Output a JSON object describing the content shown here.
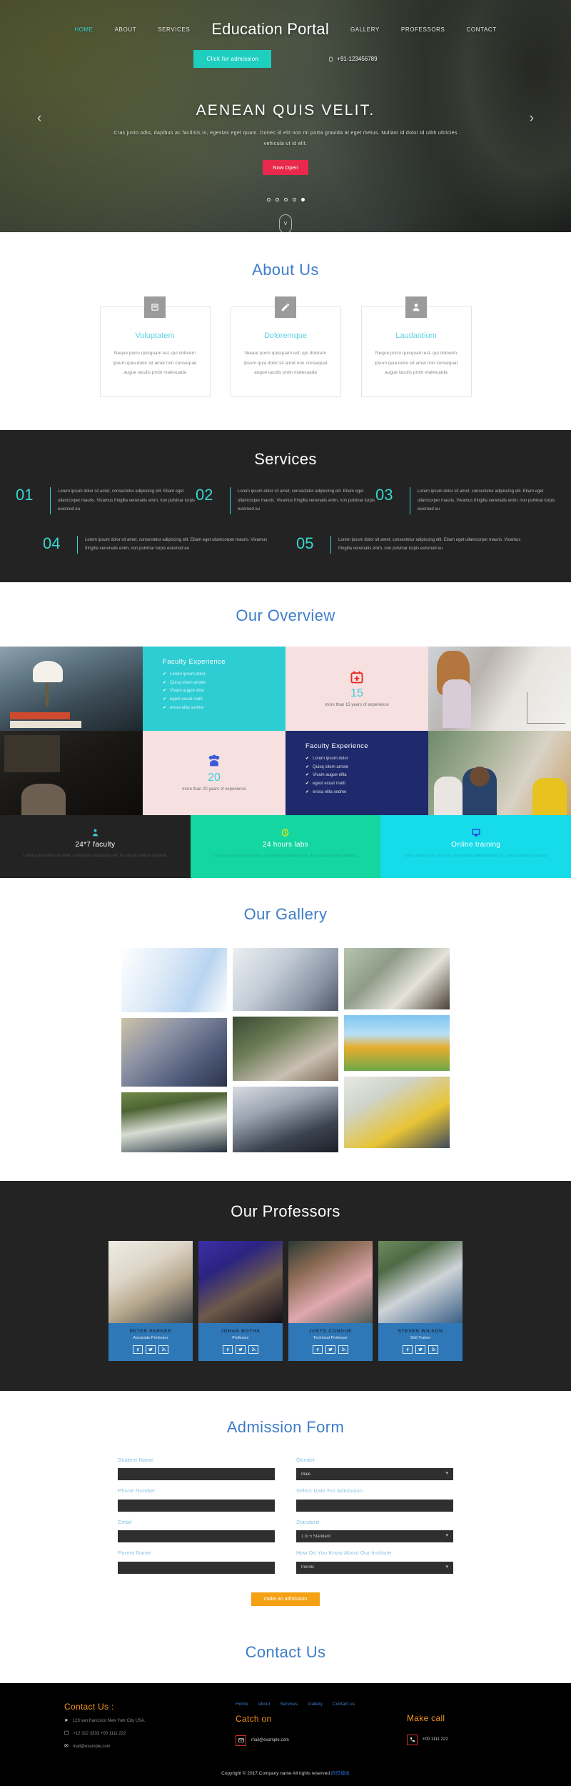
{
  "header": {
    "brand": "Education Portal",
    "nav_left": [
      {
        "label": "HOME",
        "active": true
      },
      {
        "label": "ABOUT",
        "active": false
      },
      {
        "label": "SERVICES",
        "active": false
      }
    ],
    "nav_right": [
      {
        "label": "GALLERY",
        "active": false
      },
      {
        "label": "PROFESSORS",
        "active": false
      },
      {
        "label": "CONTACT",
        "active": false
      }
    ],
    "admission_button": "Click for admission",
    "phone": "+91-123456789"
  },
  "hero": {
    "title": "AENEAN QUIS VELIT.",
    "description": "Cras justo odio, dapibus ac facilisis in, egestas eget quam. Donec id elit non mi porta gravida at eget metus. Nullam id dolor id nibh ultricies vehicula ut id elit.",
    "cta": "Now Open",
    "arrow_prev": "‹",
    "arrow_next": "›",
    "dots": [
      false,
      false,
      false,
      false,
      true
    ],
    "scroll_chevron": "˅",
    "accent_cta": "#e8294b"
  },
  "about": {
    "title": "About Us",
    "cards": [
      {
        "icon": "book-icon",
        "heading": "Voluptatem",
        "body": "Neque porro quisquam est, qui dolorem ipsum quia dolor sit amet non consequat augue iaculis proin malesuada"
      },
      {
        "icon": "pencil-icon",
        "heading": "Doloremque",
        "body": "Neque porro quisquam est, qui dolorem ipsum quia dolor sit amet non consequat augue iaculis proin malesuada"
      },
      {
        "icon": "user-icon",
        "heading": "Laudantium",
        "body": "Neque porro quisquam est, qui dolorem ipsum quia dolor sit amet non consequat augue iaculis proin malesuada"
      }
    ]
  },
  "services": {
    "title": "Services",
    "short_text": "Lorem ipsum dolor sit amet, consectetur adipiscing elit. Etiam eget ullamcorper mauris. Vivamus fringilla venenatis enim, non pulvinar turpis euismod eu",
    "items_row1": [
      {
        "num": "01"
      },
      {
        "num": "02"
      },
      {
        "num": "03"
      }
    ],
    "items_row2": [
      {
        "num": "04"
      },
      {
        "num": "05"
      }
    ]
  },
  "overview": {
    "title": "Our Overview",
    "faculty_heading": "Faculty Experience",
    "faculty_list": [
      "Lorem ipsum dolor",
      "Quisq sitem amete",
      "Vivam augue elita",
      "egest exuat matti",
      "erosa elita sedme"
    ],
    "stat_15": {
      "icon": "calendar-plus-icon",
      "number": "15",
      "caption": "more than 15 years of experience"
    },
    "stat_20": {
      "icon": "group-users-icon",
      "number": "20",
      "caption": "more than 20 years of experience"
    },
    "strip_text": "Lorem ipsum dolor sit amet, consectetur adipiscing elit. In congue pretium placerat.",
    "strips": [
      {
        "icon": "person-icon",
        "title": "24*7 faculty"
      },
      {
        "icon": "clock-icon",
        "title": "24 hours labs"
      },
      {
        "icon": "monitor-icon",
        "title": "Online training"
      }
    ]
  },
  "gallery": {
    "title": "Our Gallery"
  },
  "professors": {
    "title": "Our Professors",
    "people": [
      {
        "name": "PETER PARKER",
        "role": "Associate Professor"
      },
      {
        "name": "JOHAN BOTHA",
        "role": "Professor"
      },
      {
        "name": "JUSTO CONGUE",
        "role": "Technical Professor"
      },
      {
        "name": "STEVEN WILSON",
        "role": "Skill Trainer"
      }
    ],
    "social": [
      "facebook-icon",
      "twitter-icon",
      "rss-icon"
    ]
  },
  "admission": {
    "title": "Admission Form",
    "fields_left": [
      {
        "label": "Student Name",
        "type": "text",
        "value": ""
      },
      {
        "label": "Phone Number",
        "type": "text",
        "value": ""
      },
      {
        "label": "Email",
        "type": "text",
        "value": ""
      },
      {
        "label": "Parent Name",
        "type": "text",
        "value": ""
      }
    ],
    "fields_right": [
      {
        "label": "Gender",
        "type": "select",
        "value": "Male"
      },
      {
        "label": "Select Date For Admission",
        "type": "text",
        "value": ""
      },
      {
        "label": "Standard",
        "type": "select",
        "value": "1 to 5 Standard"
      },
      {
        "label": "How Do You Know About Our Institute",
        "type": "select",
        "value": "friends"
      }
    ],
    "submit": "make an admission"
  },
  "contact": {
    "title": "Contact Us"
  },
  "footer": {
    "contact_heading": "Contact Us :",
    "address": "123 san francisco New York City USA.",
    "phones": "+12 322 3333 +00 1111 222",
    "email": "mail@example.com",
    "links": [
      "Home",
      "About",
      "Services",
      "Gallery",
      "Contact us"
    ],
    "catch_heading": "Catch on",
    "catch_value": "mail@example.com",
    "call_heading": "Make call",
    "call_value": "+00 1111 222",
    "copyright": "Copyright © 2017.Company name All rights reserved.",
    "copyright_link": "网页模板"
  }
}
